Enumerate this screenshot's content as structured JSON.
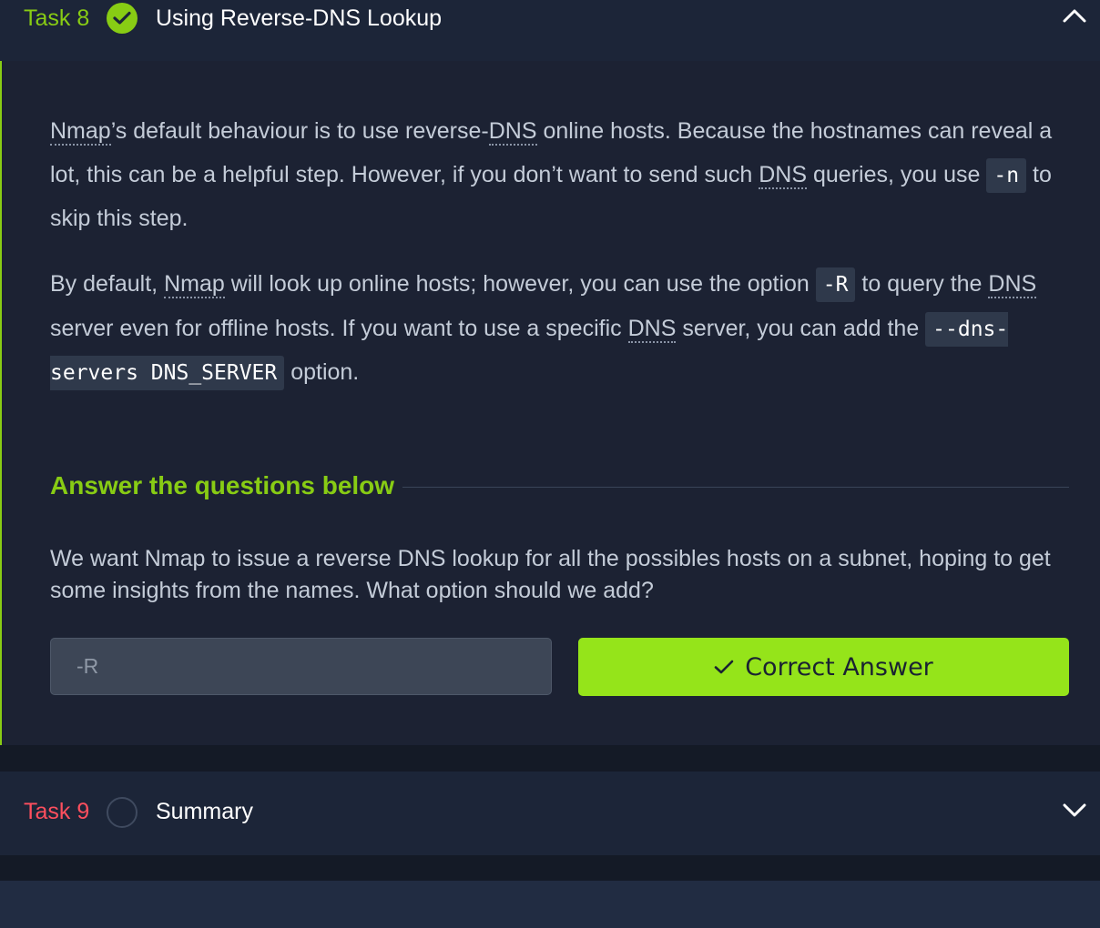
{
  "task8": {
    "number": "Task 8",
    "title": "Using Reverse-DNS Lookup",
    "status": "completed"
  },
  "content": {
    "p1": {
      "abbr1": "Nmap",
      "t1": "’s default behaviour is to use reverse-",
      "abbr2": "DNS",
      "t2": " online hosts. Because the hostnames can reveal a lot, this can be a helpful step. However, if you don’t want to send such ",
      "abbr3": "DNS",
      "t3": " queries, you use ",
      "code1": "-n",
      "t4": " to skip this step."
    },
    "p2": {
      "t1": "By default, ",
      "abbr1": "Nmap",
      "t2": " will look up online hosts; however, you can use the option ",
      "code1": "-R",
      "t3": " to query the ",
      "abbr2": "DNS",
      "t4": " server even for offline hosts. If you want to use a specific ",
      "abbr3": "DNS",
      "t5": " server, you can add the ",
      "code2": "--dns-servers DNS_SERVER",
      "t6": " option."
    }
  },
  "answers": {
    "heading": "Answer the questions below",
    "question": "We want Nmap to issue a reverse DNS lookup for all the possibles hosts on a subnet, hoping to get some insights from the names. What option should we add?",
    "input_value": "-R",
    "button_label": "Correct Answer"
  },
  "task9": {
    "number": "Task 9",
    "title": "Summary",
    "status": "incomplete"
  },
  "colors": {
    "accent_green": "#88cc14",
    "button_green": "#95e41a",
    "task_red": "#ff4f5e",
    "header_bg": "#1c2538",
    "body_bg": "#1c2233"
  }
}
